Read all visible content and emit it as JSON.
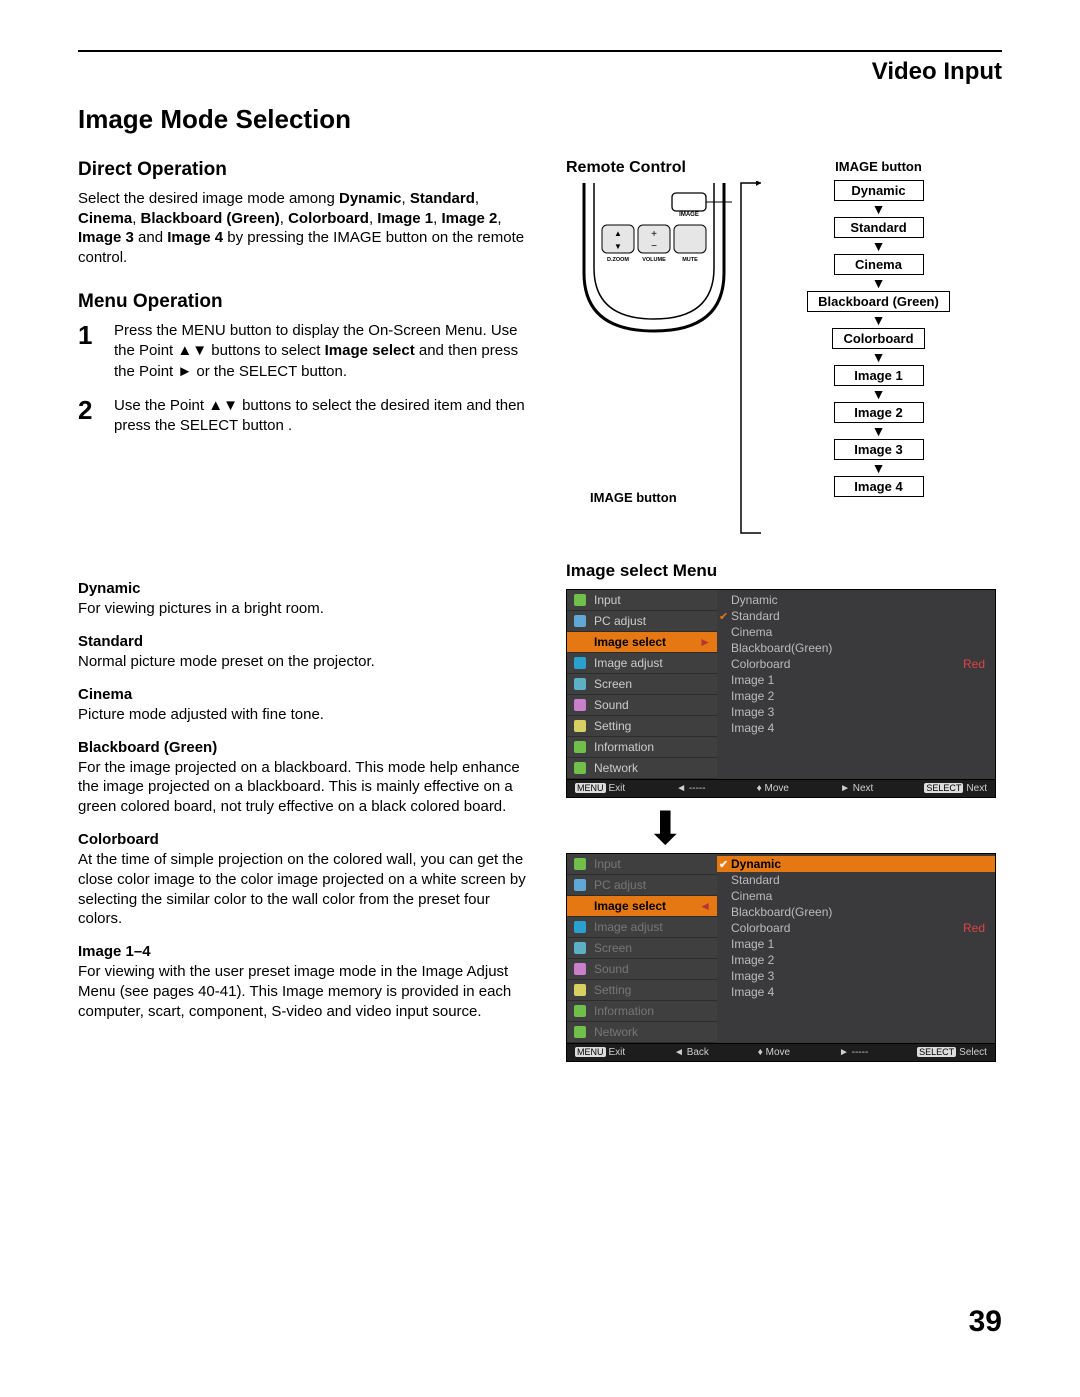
{
  "header": {
    "section": "Video Input"
  },
  "title": "Image Mode Selection",
  "direct_operation": {
    "heading": "Direct Operation",
    "text_pre": "Select the desired image mode among ",
    "modes": [
      "Dynamic",
      "Standard",
      "Cinema",
      "Blackboard (Green)",
      "Colorboard",
      "Image 1",
      "Image 2",
      "Image 3",
      "Image 4"
    ],
    "text_post": " by pressing the IMAGE button on the remote control."
  },
  "menu_operation": {
    "heading": "Menu Operation",
    "steps": [
      {
        "n": "1",
        "pre": "Press the MENU button to display the On-Screen Menu. Use the Point ▲▼ buttons to select ",
        "bold": "Image  select",
        "post": " and then press the Point ► or the SELECT button."
      },
      {
        "n": "2",
        "pre": "Use the Point  ▲▼ buttons to select  the desired item and then press the SELECT button .",
        "bold": "",
        "post": ""
      }
    ]
  },
  "modes_detail": [
    {
      "term": "Dynamic",
      "desc": "For viewing pictures in a bright room."
    },
    {
      "term": "Standard",
      "desc": "Normal picture mode preset on the projector."
    },
    {
      "term": "Cinema",
      "desc": "Picture mode adjusted with fine tone."
    },
    {
      "term": "Blackboard (Green)",
      "desc": "For the image projected on a blackboard.\nThis mode help enhance the image projected on a blackboard. This is mainly effective on a green colored board, not truly effective on a black colored board."
    },
    {
      "term": "Colorboard",
      "desc": "At the time of simple projection on the colored wall, you can get the close color image to the color image projected on a white screen by selecting the similar color to the wall color from the preset four colors."
    },
    {
      "term": "Image 1–4",
      "desc": "For viewing with the user preset image mode in the Image Adjust Menu (see pages 40-41). This Image memory is provided in each computer, scart, component, S-video and video input source."
    }
  ],
  "remote": {
    "heading": "Remote Control",
    "caption_left": "IMAGE button",
    "buttons": {
      "image": "IMAGE",
      "dzoom": "D.ZOOM",
      "volume": "VOLUME",
      "mute": "MUTE"
    }
  },
  "flow": {
    "title": "IMAGE button",
    "items": [
      "Dynamic",
      "Standard",
      "Cinema",
      "Blackboard (Green)",
      "Colorboard",
      "Image 1",
      "Image 2",
      "Image 3",
      "Image 4"
    ]
  },
  "osd": {
    "heading": "Image select Menu",
    "nav": [
      "Input",
      "PC adjust",
      "Image select",
      "Image adjust",
      "Screen",
      "Sound",
      "Setting",
      "Information",
      "Network"
    ],
    "options": [
      "Dynamic",
      "Standard",
      "Cinema",
      "Blackboard(Green)",
      "Colorboard",
      "Image 1",
      "Image 2",
      "Image 3",
      "Image 4"
    ],
    "panel1": {
      "nav_highlight": 2,
      "opt_check": 1,
      "opt_highlight": -1,
      "extra_tag": "Red",
      "footer": {
        "exit": "Exit",
        "back": "◄ -----",
        "move": "♦ Move",
        "next": "► Next",
        "select": "Next"
      }
    },
    "panel2": {
      "nav_highlight": 2,
      "opt_check": 0,
      "opt_highlight": 0,
      "extra_tag": "Red",
      "dimmed": true,
      "footer": {
        "exit": "Exit",
        "back": "◄ Back",
        "move": "♦ Move",
        "next": "► -----",
        "select": "Select"
      }
    }
  },
  "page_number": "39"
}
